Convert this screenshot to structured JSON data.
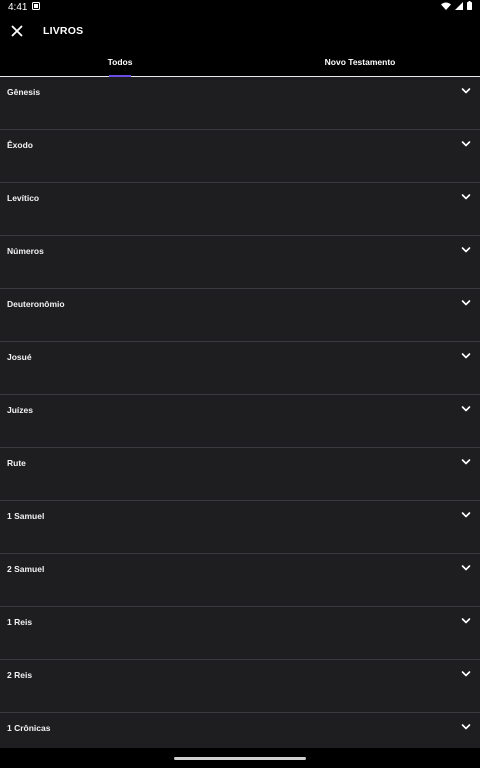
{
  "status_bar": {
    "time": "4:41",
    "icons": [
      "notification-icon",
      "wifi-icon",
      "signal-icon",
      "battery-icon"
    ]
  },
  "app_bar": {
    "title": "LIVROS",
    "close_icon": "close-icon"
  },
  "tabs": [
    {
      "label": "Todos",
      "active": true
    },
    {
      "label": "Novo Testamento",
      "active": false
    }
  ],
  "books": [
    {
      "name": "Gênesis"
    },
    {
      "name": "Êxodo"
    },
    {
      "name": "Levítico"
    },
    {
      "name": "Números"
    },
    {
      "name": "Deuteronômio"
    },
    {
      "name": "Josué"
    },
    {
      "name": "Juízes"
    },
    {
      "name": "Rute"
    },
    {
      "name": "1 Samuel"
    },
    {
      "name": "2 Samuel"
    },
    {
      "name": "1 Reis"
    },
    {
      "name": "2 Reis"
    },
    {
      "name": "1 Crônicas"
    }
  ],
  "colors": {
    "background": "#000000",
    "list_background": "#1e1e20",
    "divider": "#3a3a3e",
    "tab_indicator": "#6b4de6",
    "text": "#ffffff"
  }
}
